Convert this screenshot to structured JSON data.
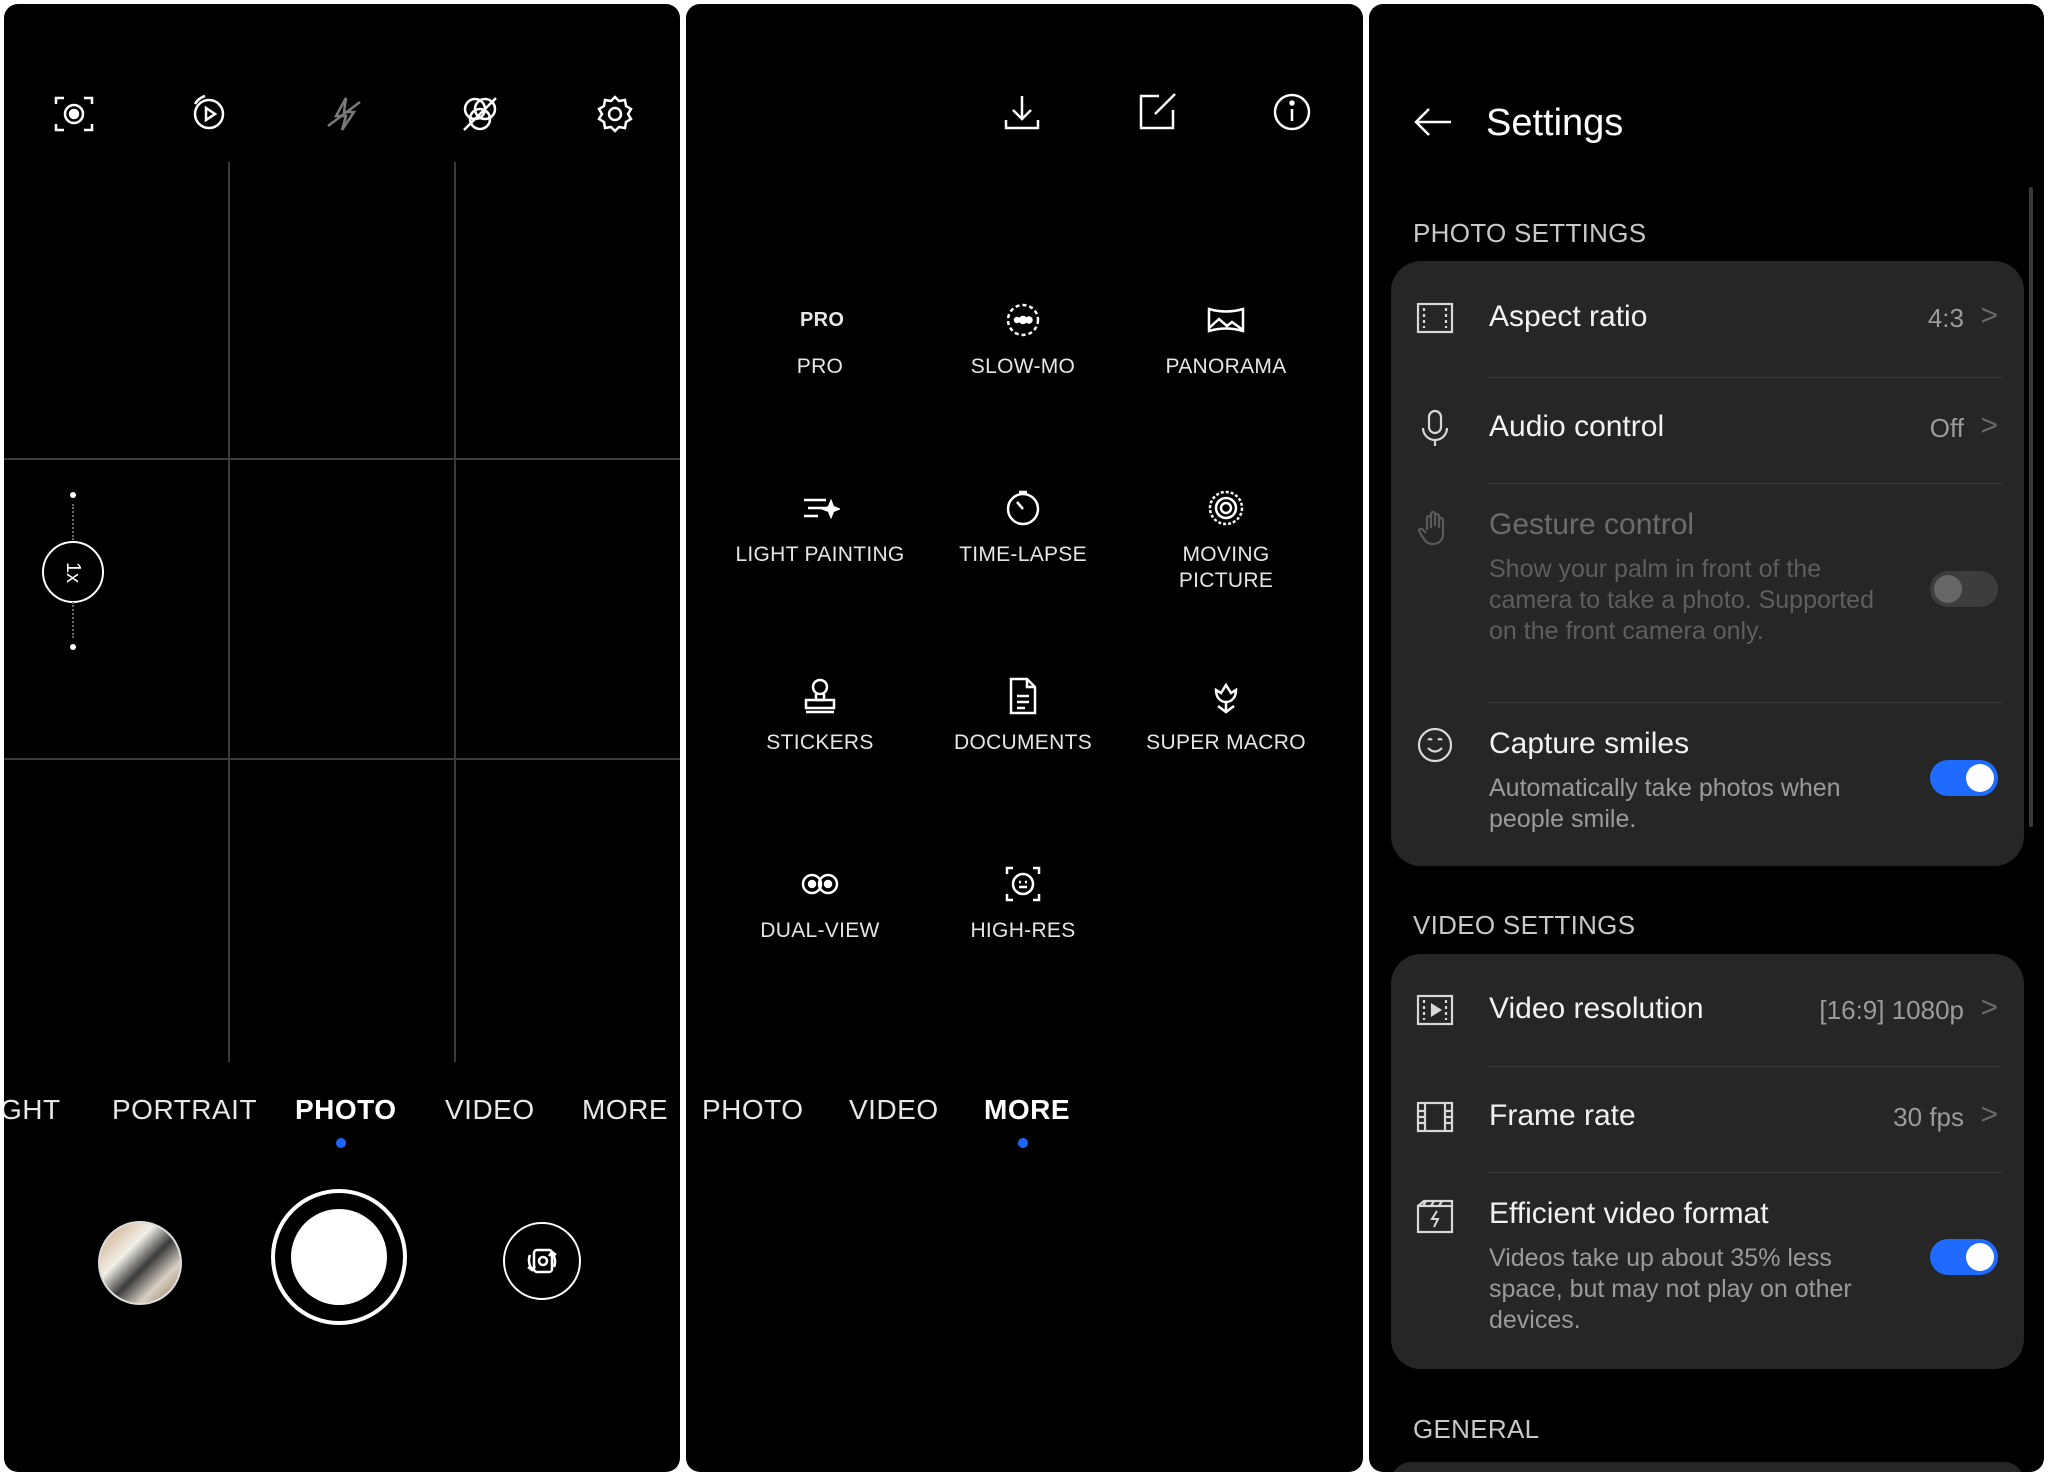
{
  "camera": {
    "zoom_label": "1x",
    "modes": [
      "GHT",
      "PORTRAIT",
      "PHOTO",
      "VIDEO",
      "MORE"
    ],
    "active_mode": "PHOTO",
    "top_icons": [
      "ai-lens-icon",
      "moving-picture-icon",
      "flash-off-icon",
      "filter-off-icon",
      "settings-gear-icon"
    ]
  },
  "more_modes": {
    "top_icons": [
      "download-icon",
      "edit-icon",
      "info-icon"
    ],
    "tiles": [
      {
        "label": "PRO",
        "glyph": "PRO"
      },
      {
        "label": "SLOW-MO"
      },
      {
        "label": "PANORAMA"
      },
      {
        "label": "LIGHT PAINTING"
      },
      {
        "label": "TIME-LAPSE"
      },
      {
        "label": "MOVING PICTURE"
      },
      {
        "label": "STICKERS"
      },
      {
        "label": "DOCUMENTS"
      },
      {
        "label": "SUPER MACRO"
      },
      {
        "label": "DUAL-VIEW"
      },
      {
        "label": "HIGH-RES"
      }
    ],
    "modes": [
      "PHOTO",
      "VIDEO",
      "MORE"
    ],
    "active_mode": "MORE"
  },
  "settings": {
    "title": "Settings",
    "photo_section": "PHOTO SETTINGS",
    "aspect_ratio": {
      "title": "Aspect ratio",
      "value": "4:3"
    },
    "audio_control": {
      "title": "Audio control",
      "value": "Off"
    },
    "gesture_control": {
      "title": "Gesture control",
      "desc": "Show your palm in front of the camera to take a photo. Supported on the front camera only.",
      "enabled": false
    },
    "capture_smiles": {
      "title": "Capture smiles",
      "desc": "Automatically take photos when people smile.",
      "enabled": true
    },
    "video_section": "VIDEO SETTINGS",
    "video_resolution": {
      "title": "Video resolution",
      "value": "[16:9] 1080p"
    },
    "frame_rate": {
      "title": "Frame rate",
      "value": "30 fps"
    },
    "efficient_format": {
      "title": "Efficient video format",
      "desc": "Videos take up about 35% less space, but may not play on other devices.",
      "enabled": true
    },
    "general_section": "GENERAL",
    "chevron": ">"
  }
}
